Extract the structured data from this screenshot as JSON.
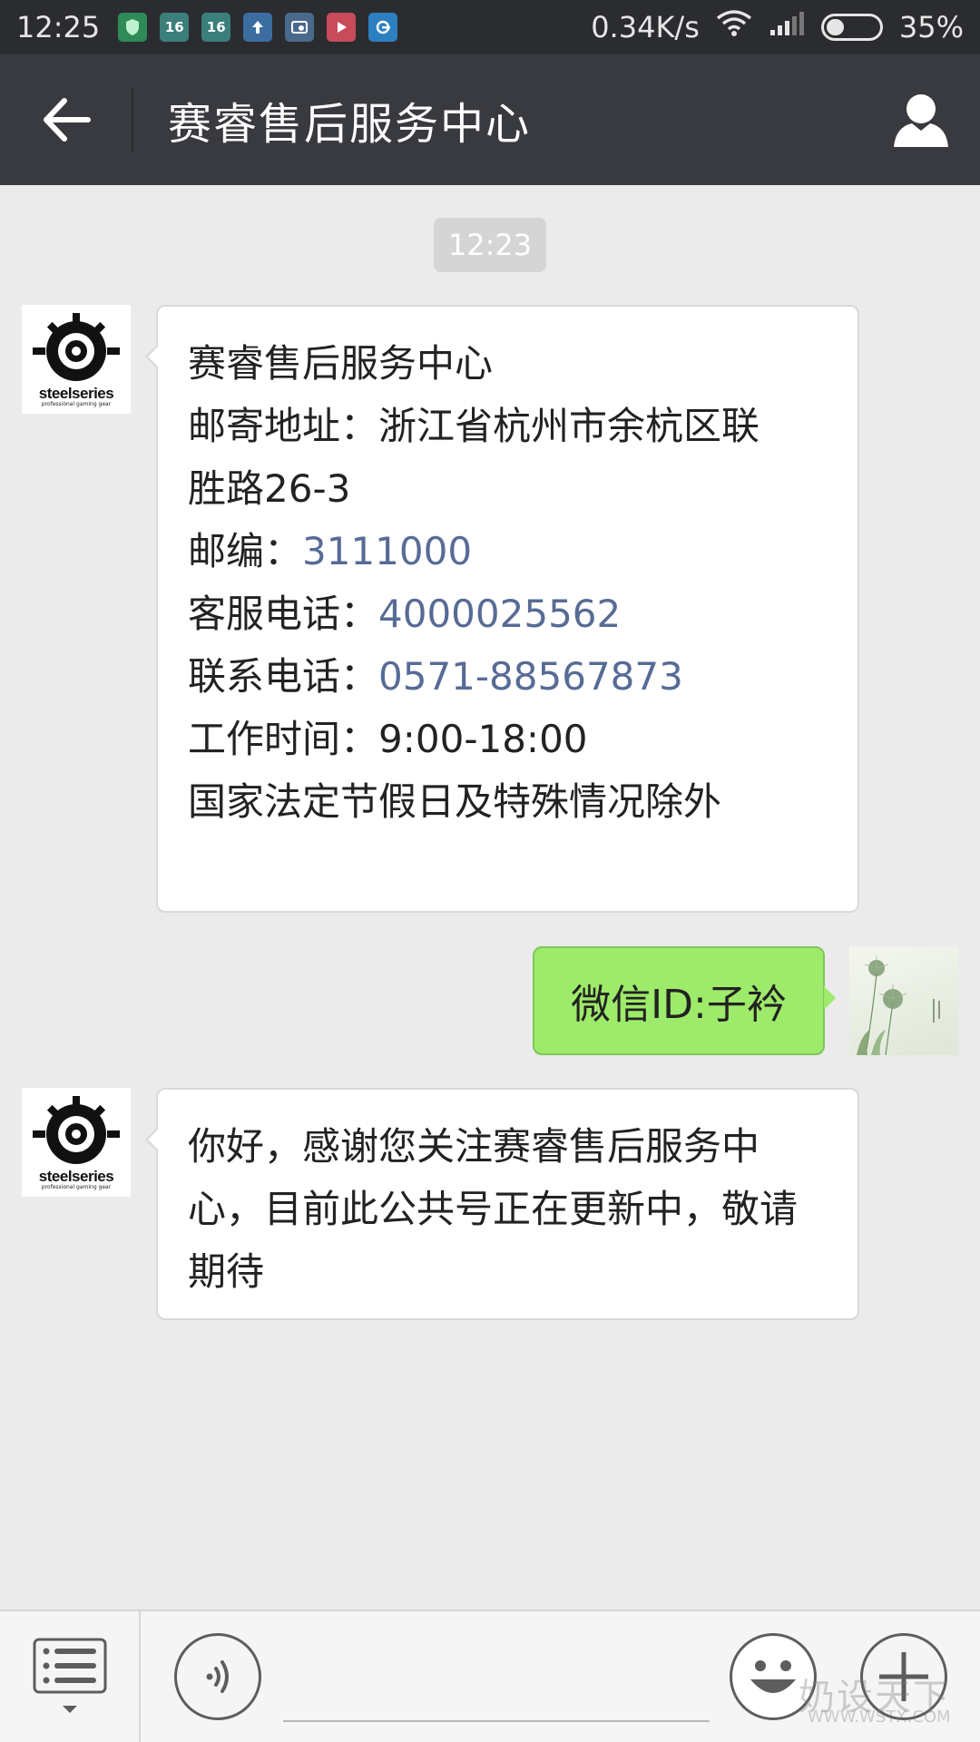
{
  "status_bar": {
    "time": "12:25",
    "notifications": [
      {
        "icon": "security-shield-icon",
        "text": "",
        "color": "#2e8b57"
      },
      {
        "icon": "app-16-icon",
        "text": "16",
        "color": "#3a7f7a"
      },
      {
        "icon": "app-16-icon",
        "text": "16",
        "color": "#3a7f7a"
      },
      {
        "icon": "upload-arrow-icon",
        "text": "",
        "color": "#3c6da0"
      },
      {
        "icon": "clock-app-icon",
        "text": "",
        "color": "#4a6a8c"
      },
      {
        "icon": "video-app-icon",
        "text": "",
        "color": "#c84b5a"
      },
      {
        "icon": "browser-app-icon",
        "text": "",
        "color": "#2c7fc0"
      }
    ],
    "network_speed": "0.34K/s",
    "battery_percent": "35%",
    "battery_level": 0.35
  },
  "header": {
    "title": "赛睿售后服务中心"
  },
  "chat": {
    "timestamp": "12:23",
    "avatar_brand": "steelseries",
    "avatar_tagline": "professional gaming gear",
    "message1": {
      "line1": "赛睿售后服务中心",
      "line2": "邮寄地址：浙江省杭州市余杭区联",
      "line3": "胜路26-3",
      "postcode_label": "邮编：",
      "postcode": "3111000",
      "service_phone_label": "客服电话：",
      "service_phone": "4000025562",
      "contact_phone_label": "联系电话：",
      "contact_phone": "0571-88567873",
      "hours": "工作时间：9:00-18:00",
      "note": "国家法定节假日及特殊情况除外"
    },
    "user_message": "微信ID:子衿",
    "message2": {
      "line1": "你好，感谢您关注赛睿售后服务中",
      "line2": "心，目前此公共号正在更新中，敬请",
      "line3": "期待"
    }
  },
  "bottom_bar": {
    "watermark": "奶设天下",
    "watermark_sub": "WWW.WSTX.COM"
  }
}
